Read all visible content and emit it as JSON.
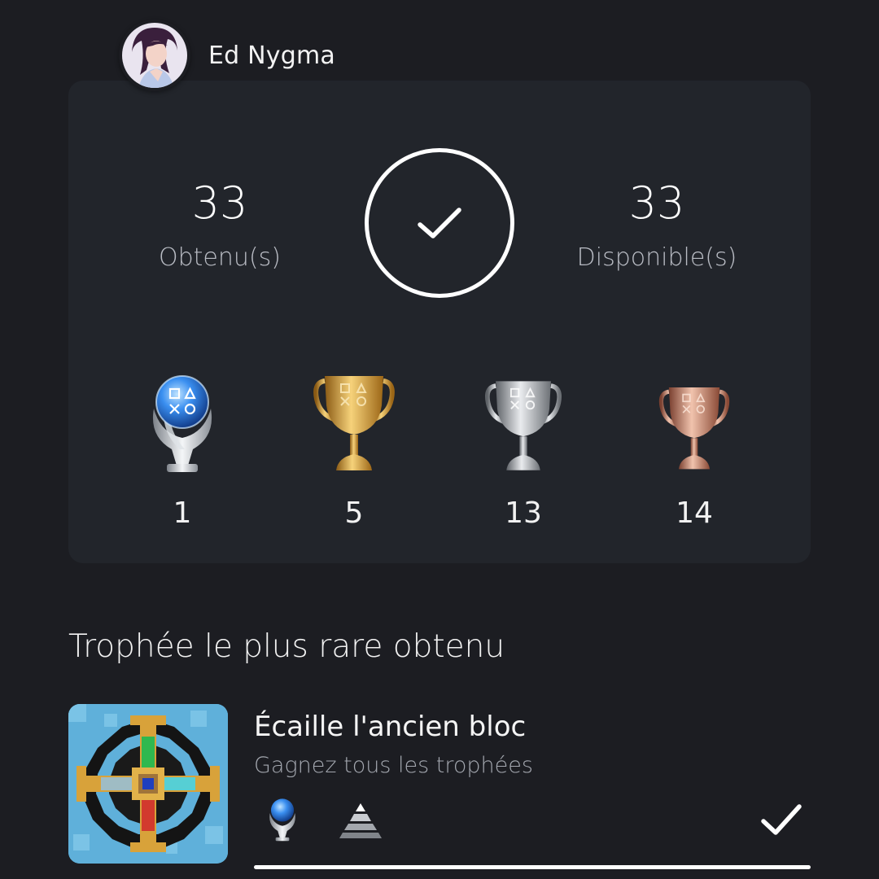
{
  "user": {
    "name": "Ed Nygma",
    "avatar_icon": "user-avatar"
  },
  "summary": {
    "earned_count": "33",
    "earned_label": "Obtenu(s)",
    "available_count": "33",
    "available_label": "Disponible(s)",
    "completion_icon": "checkmark-icon",
    "progress_percent": 100
  },
  "tiers": [
    {
      "name": "platinum",
      "icon": "platinum-trophy-icon",
      "count": "1"
    },
    {
      "name": "gold",
      "icon": "gold-trophy-icon",
      "count": "5"
    },
    {
      "name": "silver",
      "icon": "silver-trophy-icon",
      "count": "13"
    },
    {
      "name": "bronze",
      "icon": "bronze-trophy-icon",
      "count": "14"
    }
  ],
  "rarest": {
    "section_title": "Trophée le plus rare obtenu",
    "title": "Écaille l'ancien bloc",
    "description": "Gagnez tous les trophées",
    "grade_icon": "platinum-trophy-icon",
    "rarity_icon": "rarity-pyramid-icon",
    "status_icon": "checkmark-icon",
    "progress_percent": 100
  },
  "colors": {
    "background": "#1c1d22",
    "card": "#22252b",
    "text_secondary": "#b9bcc4",
    "gold": "#d9a23a",
    "silver": "#b8bcc2",
    "bronze": "#c98a72",
    "platinum_orb": "#2f7be0"
  }
}
